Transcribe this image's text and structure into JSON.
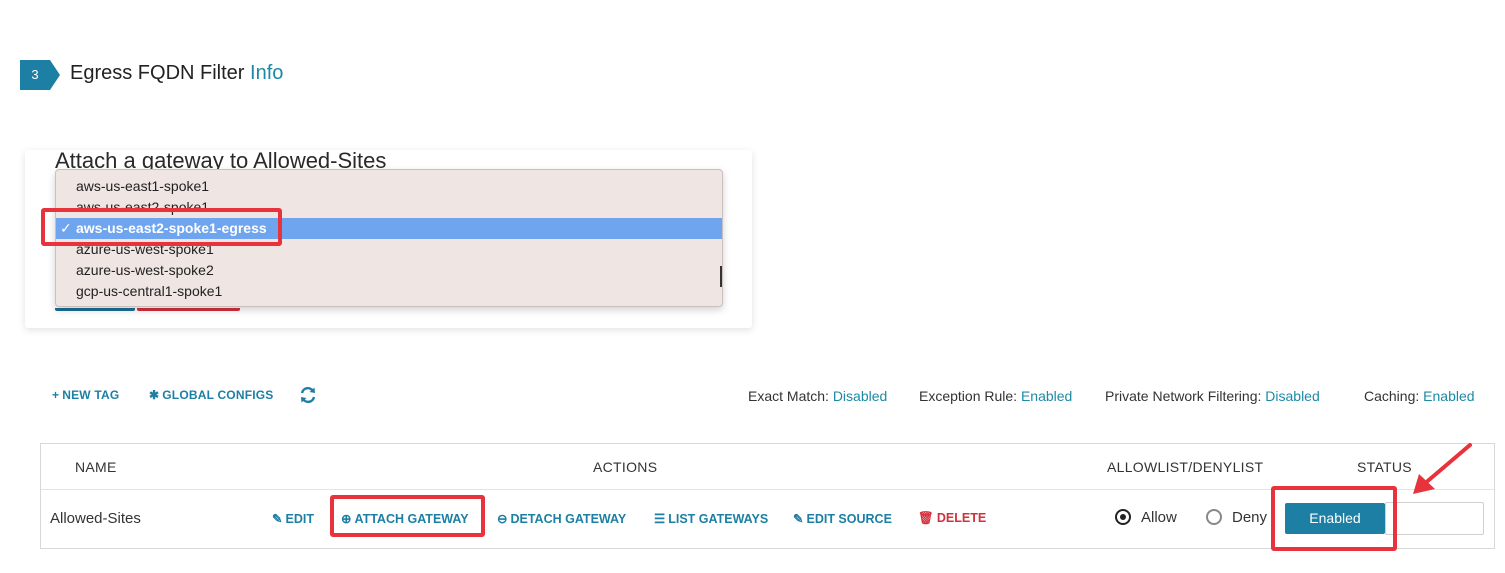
{
  "step": {
    "number": "3",
    "title": "Egress FQDN Filter",
    "info_link": "Info"
  },
  "modal": {
    "title": "Attach a gateway to Allowed-Sites",
    "options": [
      "aws-us-east1-spoke1",
      "aws-us-east2-spoke1",
      "aws-us-east2-spoke1-egress",
      "azure-us-west-spoke1",
      "azure-us-west-spoke2",
      "gcp-us-central1-spoke1"
    ],
    "selected_option": "aws-us-east2-spoke1-egress",
    "check_glyph": "✓"
  },
  "toolbar": {
    "new_tag": "NEW TAG",
    "global_configs": "GLOBAL CONFIGS",
    "refresh_icon": "refresh-icon",
    "settings": [
      {
        "label": "Exact Match:",
        "value": "Disabled"
      },
      {
        "label": "Exception Rule:",
        "value": "Enabled"
      },
      {
        "label": "Private Network Filtering:",
        "value": "Disabled"
      },
      {
        "label": "Caching:",
        "value": "Enabled"
      }
    ]
  },
  "table": {
    "headers": {
      "name": "NAME",
      "actions": "ACTIONS",
      "list": "ALLOWLIST/DENYLIST",
      "status": "STATUS"
    },
    "row": {
      "name": "Allowed-Sites",
      "actions": {
        "edit": "EDIT",
        "attach": "ATTACH GATEWAY",
        "detach": "DETACH GATEWAY",
        "list": "LIST GATEWAYS",
        "edit_source": "EDIT SOURCE",
        "delete": "DELETE"
      },
      "allow_label": "Allow",
      "deny_label": "Deny",
      "selected_mode": "Allow",
      "status": "Enabled"
    }
  },
  "colors": {
    "accent": "#1c7fa3",
    "danger": "#d3303c",
    "annotation_red": "#e8323c",
    "selection_blue": "#6fa4ef"
  }
}
